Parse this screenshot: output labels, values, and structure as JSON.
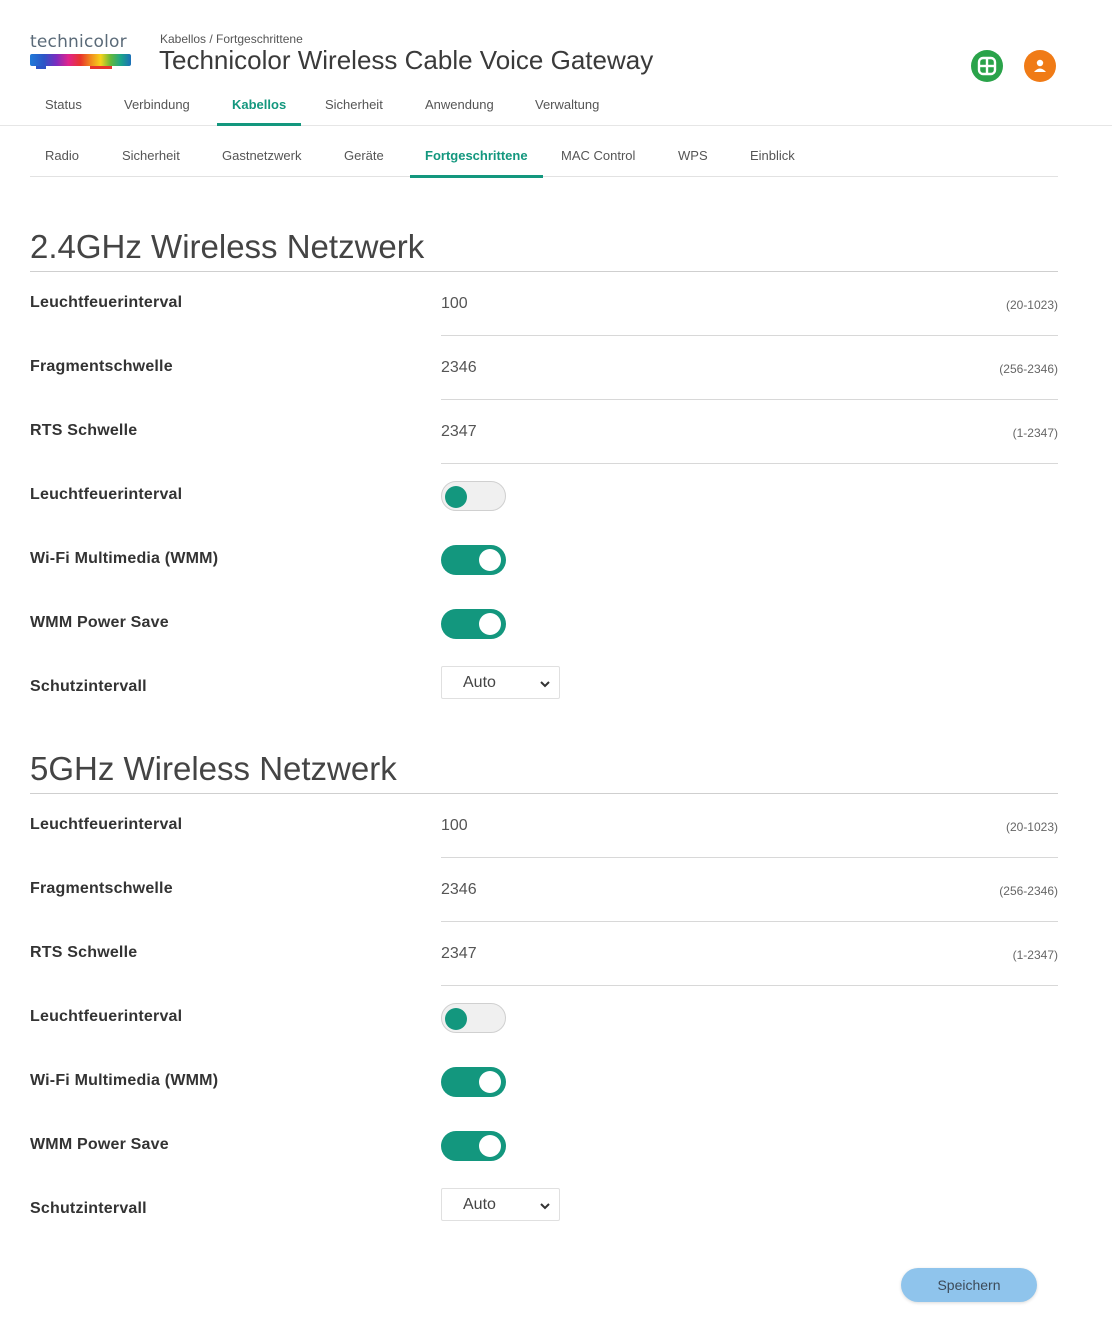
{
  "header": {
    "logo_text": "technicolor",
    "breadcrumb": "Kabellos / Fortgeschrittene",
    "title": "Technicolor Wireless Cable Voice Gateway",
    "icons": [
      "grid-icon",
      "user-icon"
    ],
    "colors": {
      "accent": "#13977e",
      "grid_icon": "#2aa34a",
      "user_icon": "#f07b16"
    }
  },
  "main_tabs": [
    "Status",
    "Verbindung",
    "Kabellos",
    "Sicherheit",
    "Anwendung",
    "Verwaltung"
  ],
  "main_tab_active": "Kabellos",
  "sub_tabs": [
    "Radio",
    "Sicherheit",
    "Gastnetzwerk",
    "Geräte",
    "Fortgeschrittene",
    "MAC Control",
    "WPS",
    "Einblick"
  ],
  "sub_tab_active": "Fortgeschrittene",
  "sections": [
    {
      "title": "2.4GHz Wireless Netzwerk",
      "beacon": {
        "label": "Leuchtfeuerinterval",
        "value": "100",
        "range": "(20-1023)"
      },
      "fragment": {
        "label": "Fragmentschwelle",
        "value": "2346",
        "range": "(256-2346)"
      },
      "rts": {
        "label": "RTS Schwelle",
        "value": "2347",
        "range": "(1-2347)"
      },
      "beacon_toggle": {
        "label": "Leuchtfeuerinterval",
        "on": false
      },
      "wmm": {
        "label": "Wi-Fi Multimedia (WMM)",
        "on": true
      },
      "wmm_power": {
        "label": "WMM Power Save",
        "on": true
      },
      "guard": {
        "label": "Schutzintervall",
        "value": "Auto"
      }
    },
    {
      "title": "5GHz Wireless Netzwerk",
      "beacon": {
        "label": "Leuchtfeuerinterval",
        "value": "100",
        "range": "(20-1023)"
      },
      "fragment": {
        "label": "Fragmentschwelle",
        "value": "2346",
        "range": "(256-2346)"
      },
      "rts": {
        "label": "RTS Schwelle",
        "value": "2347",
        "range": "(1-2347)"
      },
      "beacon_toggle": {
        "label": "Leuchtfeuerinterval",
        "on": false
      },
      "wmm": {
        "label": "Wi-Fi Multimedia (WMM)",
        "on": true
      },
      "wmm_power": {
        "label": "WMM Power Save",
        "on": true
      },
      "guard": {
        "label": "Schutzintervall",
        "value": "Auto"
      }
    }
  ],
  "save_label": "Speichern",
  "save_button_color": "#8fc4ec"
}
